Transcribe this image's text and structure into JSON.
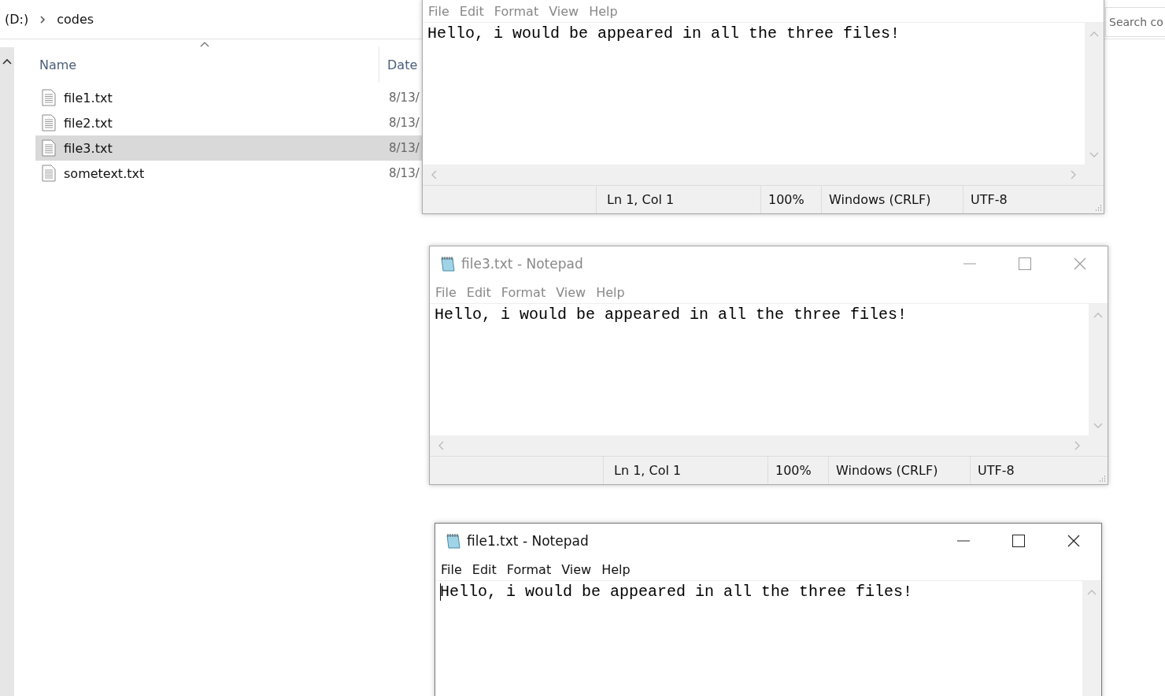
{
  "explorer": {
    "breadcrumb": [
      "(D:)",
      "codes"
    ],
    "search": {
      "placeholder": "Search co"
    },
    "columns": [
      "Name",
      "Date"
    ],
    "files": [
      {
        "name": "file1.txt",
        "date": "8/13/",
        "selected": false
      },
      {
        "name": "file2.txt",
        "date": "8/13/",
        "selected": false
      },
      {
        "name": "file3.txt",
        "date": "8/13/",
        "selected": true
      },
      {
        "name": "sometext.txt",
        "date": "8/13/",
        "selected": false
      }
    ]
  },
  "notepads": [
    {
      "active": false,
      "menu": [
        "File",
        "Edit",
        "Format",
        "View",
        "Help"
      ],
      "text": "Hello, i would be appeared in all the three files!",
      "caret": false,
      "status": {
        "position": "Ln 1, Col 1",
        "zoom": "100%",
        "line_ending": "Windows (CRLF)",
        "encoding": "UTF-8"
      }
    },
    {
      "title": "file3.txt - Notepad",
      "active": false,
      "menu": [
        "File",
        "Edit",
        "Format",
        "View",
        "Help"
      ],
      "text": "Hello, i would be appeared in all the three files!",
      "caret": false,
      "status": {
        "position": "Ln 1, Col 1",
        "zoom": "100%",
        "line_ending": "Windows (CRLF)",
        "encoding": "UTF-8"
      }
    },
    {
      "title": "file1.txt - Notepad",
      "active": true,
      "menu": [
        "File",
        "Edit",
        "Format",
        "View",
        "Help"
      ],
      "text": "Hello, i would be appeared in all the three files!",
      "caret": true
    }
  ]
}
